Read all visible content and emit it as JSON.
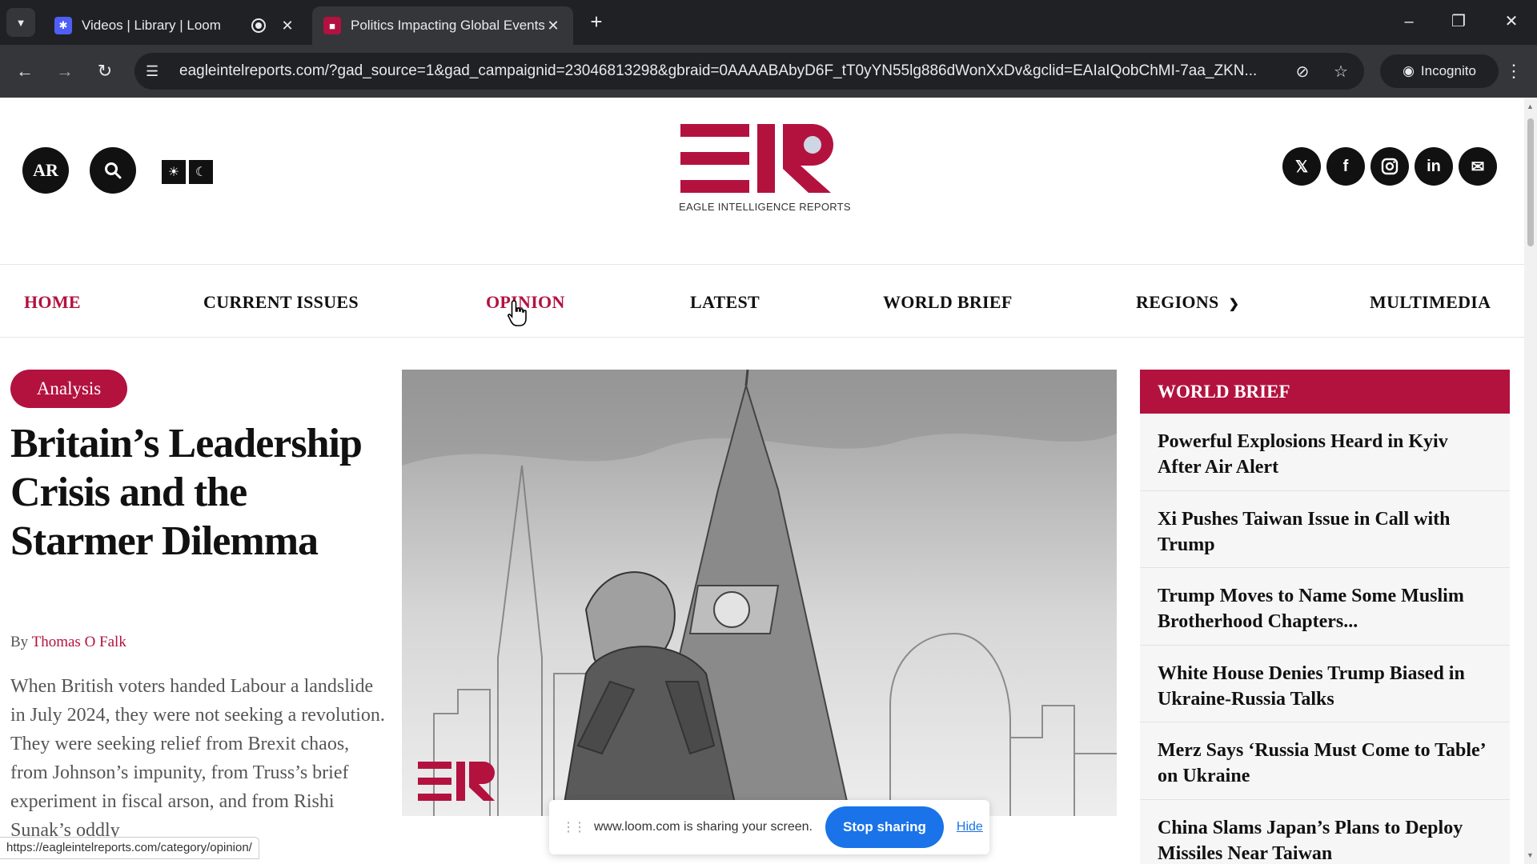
{
  "browser": {
    "tabs": [
      {
        "title": "Videos | Library | Loom",
        "favicon": "loom-icon",
        "recording": true
      },
      {
        "title": "Politics Impacting Global Events",
        "favicon": "eir-icon",
        "active": true
      }
    ],
    "url": "eagleintelreports.com/?gad_source=1&gad_campaignid=23046813298&gbraid=0AAAABAbyD6F_tT0yYN55lg886dWonXxDv&gclid=EAIaIQobChMI-7aa_ZKN...",
    "incognito_label": "Incognito",
    "hover_link": "https://eagleintelreports.com/category/opinion/"
  },
  "site": {
    "accent_color": "#b3123f",
    "lang_button": "AR",
    "logo_tagline": "EAGLE INTELLIGENCE REPORTS",
    "nav": [
      {
        "label": "HOME",
        "active": true
      },
      {
        "label": "CURRENT ISSUES"
      },
      {
        "label": "OPINION",
        "hovered": true
      },
      {
        "label": "LATEST"
      },
      {
        "label": "WORLD BRIEF"
      },
      {
        "label": "REGIONS",
        "has_dropdown": true
      },
      {
        "label": "MULTIMEDIA"
      }
    ],
    "socials": [
      "x-icon",
      "facebook-icon",
      "instagram-icon",
      "linkedin-icon",
      "mail-icon"
    ],
    "article": {
      "category": "Analysis",
      "headline": "Britain’s Leadership Crisis and the Starmer Dilemma",
      "by": "By",
      "author": "Thomas O Falk",
      "lede": "When British voters handed Labour a landslide in July 2024, they were not seeking a revolution. They were seeking relief from Brexit chaos, from Johnson’s impunity, from Truss’s brief experiment in fiscal arson, and from Rishi Sunak’s oddly"
    },
    "world_brief": {
      "title": "WORLD BRIEF",
      "items": [
        "Powerful Explosions Heard in Kyiv After Air Alert",
        "Xi Pushes Taiwan Issue in Call with Trump",
        "Trump Moves to Name Some Muslim Brotherhood Chapters...",
        "White House Denies Trump Biased in Ukraine-Russia Talks",
        "Merz Says ‘Russia Must Come to Table’ on Ukraine",
        "China Slams Japan’s Plans to Deploy Missiles Near Taiwan"
      ]
    }
  },
  "screen_share": {
    "message": "www.loom.com is sharing your screen.",
    "stop_label": "Stop sharing",
    "hide_label": "Hide"
  }
}
